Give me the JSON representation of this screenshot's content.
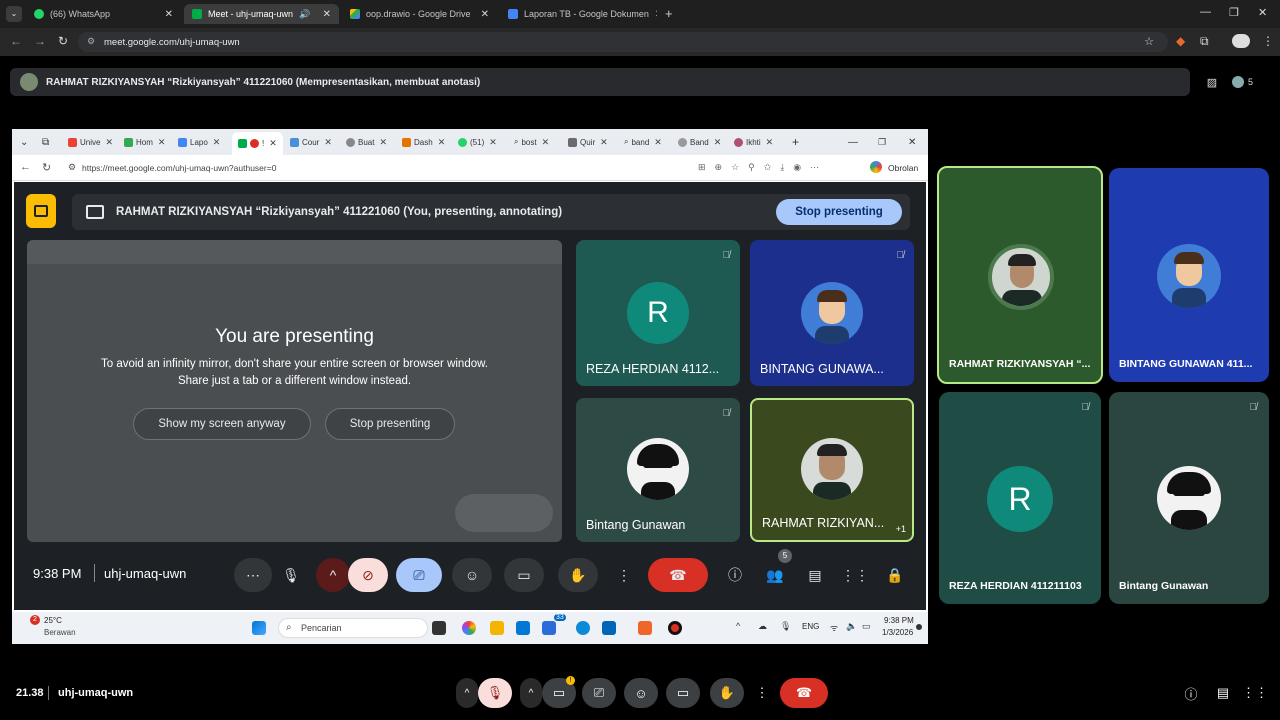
{
  "browser": {
    "tabs": [
      {
        "label": "(66) WhatsApp",
        "color": "#25d366"
      },
      {
        "label": "Meet - uhj-umaq-uwn",
        "color": "#00ac47"
      },
      {
        "label": "oop.drawio - Google Drive",
        "color": "#fbbc04"
      },
      {
        "label": "Laporan TB - Google Dokumen",
        "color": "#4285f4"
      }
    ],
    "url": "meet.google.com/uhj-umaq-uwn"
  },
  "banner": {
    "text": "RAHMAT RIZKIYANSYAH “Rizkiyansyah” 411221060 (Mempresentasikan, membuat anotasi)",
    "participant_count": "5"
  },
  "inner_browser": {
    "tabs": [
      "Unive",
      "Hom",
      "Lapo",
      "!",
      "Cour",
      "Buat",
      "Dash",
      "(51)",
      "bost",
      "Quir",
      "band",
      "Band",
      "Ikhti"
    ],
    "url": "https://meet.google.com/uhj-umaq-uwn?authuser=0",
    "chat_label": "Obrolan"
  },
  "meet": {
    "header_text": "RAHMAT RIZKIYANSYAH “Rizkiyansyah” 411221060 (You, presenting, annotating)",
    "stop_presenting": "Stop presenting",
    "presenting_title": "You are presenting",
    "presenting_msg_1": "To avoid an infinity mirror, don't share your entire screen or browser window.",
    "presenting_msg_2": "Share just a tab or a different window instead.",
    "show_anyway": "Show my screen anyway",
    "stop_btn": "Stop presenting",
    "tiles": [
      {
        "name": "REZA HERDIAN 4112...",
        "letter": "R"
      },
      {
        "name": "BINTANG GUNAWA..."
      },
      {
        "name": "Bintang Gunawan"
      },
      {
        "name": "RAHMAT RIZKIYAN...",
        "extra": "+1"
      }
    ],
    "time": "9:38 PM",
    "meeting_code": "uhj-umaq-uwn",
    "people_badge": "5"
  },
  "taskbar": {
    "temp": "25°C",
    "weather": "Berawan",
    "weather_badge": "2",
    "search": "Pencarian",
    "lang": "ENG",
    "clock": "9:38 PM",
    "date": "1/3/2026",
    "badge": "33"
  },
  "right_tiles": [
    {
      "name": "RAHMAT RIZKIYANSYAH “..."
    },
    {
      "name": "BINTANG GUNAWAN 411..."
    },
    {
      "name": "REZA HERDIAN 411211103",
      "letter": "R"
    },
    {
      "name": "Bintang Gunawan"
    }
  ],
  "bottom": {
    "time": "21.38",
    "code": "uhj-umaq-uwn"
  },
  "colors": {
    "end_call": "#d93025",
    "stop_blue": "#a8c7fa",
    "teal": "#0f8a7a",
    "active_border": "#b8e986"
  }
}
